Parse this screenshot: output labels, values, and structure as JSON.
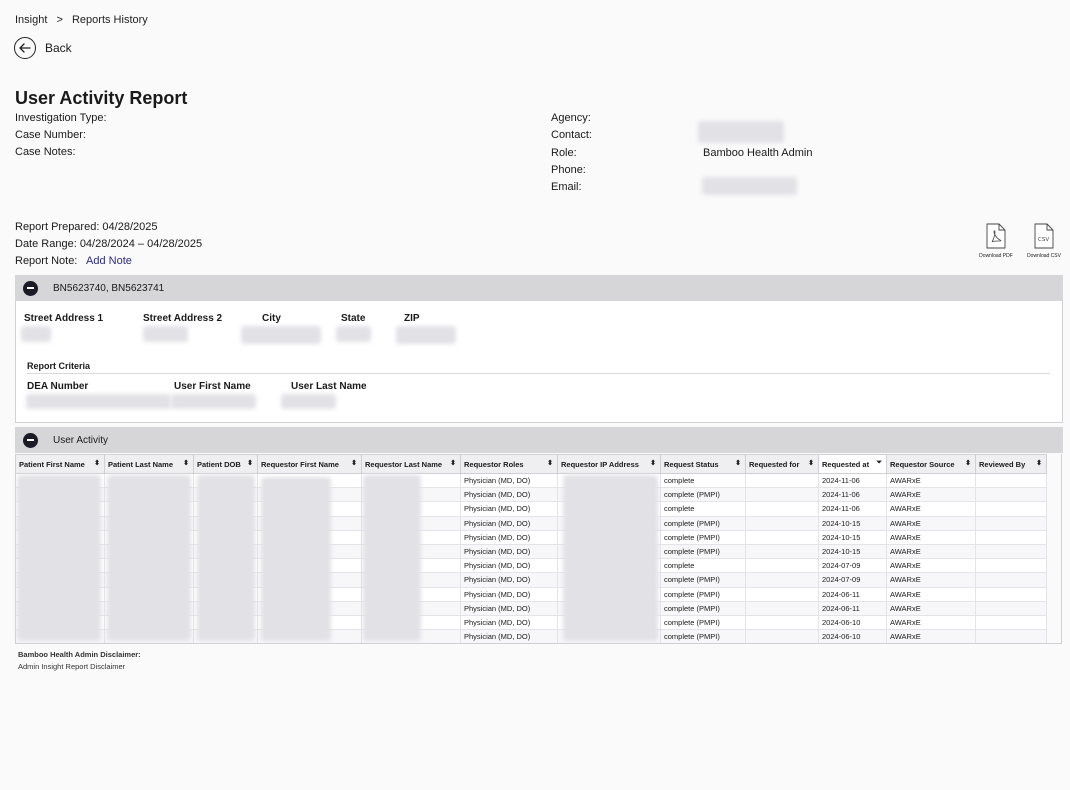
{
  "breadcrumb": {
    "root": "Insight",
    "separator": ">",
    "current": "Reports History"
  },
  "back": {
    "label": "Back",
    "icon": "arrow-left-icon"
  },
  "report": {
    "title": "User Activity Report",
    "left_fields": [
      {
        "label": "Investigation Type:"
      },
      {
        "label": "Case Number:"
      },
      {
        "label": "Case Notes:"
      }
    ],
    "right_fields": [
      {
        "label": "Agency:",
        "value": ""
      },
      {
        "label": "Contact:",
        "value": ""
      },
      {
        "label": "Role:",
        "value": "Bamboo Health Admin"
      },
      {
        "label": "Phone:",
        "value": ""
      },
      {
        "label": "Email:",
        "value": ""
      }
    ],
    "prepared": "Report Prepared: 04/28/2025",
    "date_range": "Date Range: 04/28/2024 – 04/28/2025",
    "note_label": "Report Note:",
    "add_note": "Add Note"
  },
  "downloads": {
    "pdf_label": "Download PDF",
    "csv_label": "Download CSV",
    "pdf_icon": "pdf-file-icon",
    "csv_icon": "csv-file-icon"
  },
  "identifier_section": {
    "title": "BN5623740, BN5623741",
    "address_headers": [
      "Street Address 1",
      "Street Address 2",
      "City",
      "State",
      "ZIP"
    ],
    "criteria_title": "Report Criteria",
    "criteria_headers": [
      "DEA Number",
      "User First Name",
      "User Last Name"
    ]
  },
  "activity_section": {
    "title": "User Activity",
    "columns": [
      "Patient First Name",
      "Patient Last Name",
      "Patient DOB",
      "Requestor First Name",
      "Requestor Last Name",
      "Requestor Roles",
      "Requestor IP Address",
      "Request Status",
      "Requested for",
      "Requested at",
      "Requestor Source",
      "Reviewed By"
    ],
    "rows": [
      {
        "role": "Physician (MD, DO)",
        "status": "complete",
        "requested_at": "2024-11-06",
        "source": "AWARxE"
      },
      {
        "role": "Physician (MD, DO)",
        "status": "complete (PMPI)",
        "requested_at": "2024-11-06",
        "source": "AWARxE"
      },
      {
        "role": "Physician (MD, DO)",
        "status": "complete",
        "requested_at": "2024-11-06",
        "source": "AWARxE"
      },
      {
        "role": "Physician (MD, DO)",
        "status": "complete (PMPI)",
        "requested_at": "2024-10-15",
        "source": "AWARxE"
      },
      {
        "role": "Physician (MD, DO)",
        "status": "complete (PMPI)",
        "requested_at": "2024-10-15",
        "source": "AWARxE"
      },
      {
        "role": "Physician (MD, DO)",
        "status": "complete (PMPI)",
        "requested_at": "2024-10-15",
        "source": "AWARxE"
      },
      {
        "role": "Physician (MD, DO)",
        "status": "complete",
        "requested_at": "2024-07-09",
        "source": "AWARxE"
      },
      {
        "role": "Physician (MD, DO)",
        "status": "complete (PMPI)",
        "requested_at": "2024-07-09",
        "source": "AWARxE"
      },
      {
        "role": "Physician (MD, DO)",
        "status": "complete (PMPI)",
        "requested_at": "2024-06-11",
        "source": "AWARxE"
      },
      {
        "role": "Physician (MD, DO)",
        "status": "complete (PMPI)",
        "requested_at": "2024-06-11",
        "source": "AWARxE"
      },
      {
        "role": "Physician (MD, DO)",
        "status": "complete (PMPI)",
        "requested_at": "2024-06-10",
        "source": "AWARxE"
      },
      {
        "role": "Physician (MD, DO)",
        "status": "complete (PMPI)",
        "requested_at": "2024-06-10",
        "source": "AWARxE"
      }
    ]
  },
  "disclaimer": {
    "title": "Bamboo Health Admin Disclaimer:",
    "text": "Admin Insight Report Disclaimer"
  },
  "colors": {
    "accent_link": "#2b2a8a",
    "section_bar": "#d6d5d8",
    "redaction": "#e2e1e6"
  }
}
